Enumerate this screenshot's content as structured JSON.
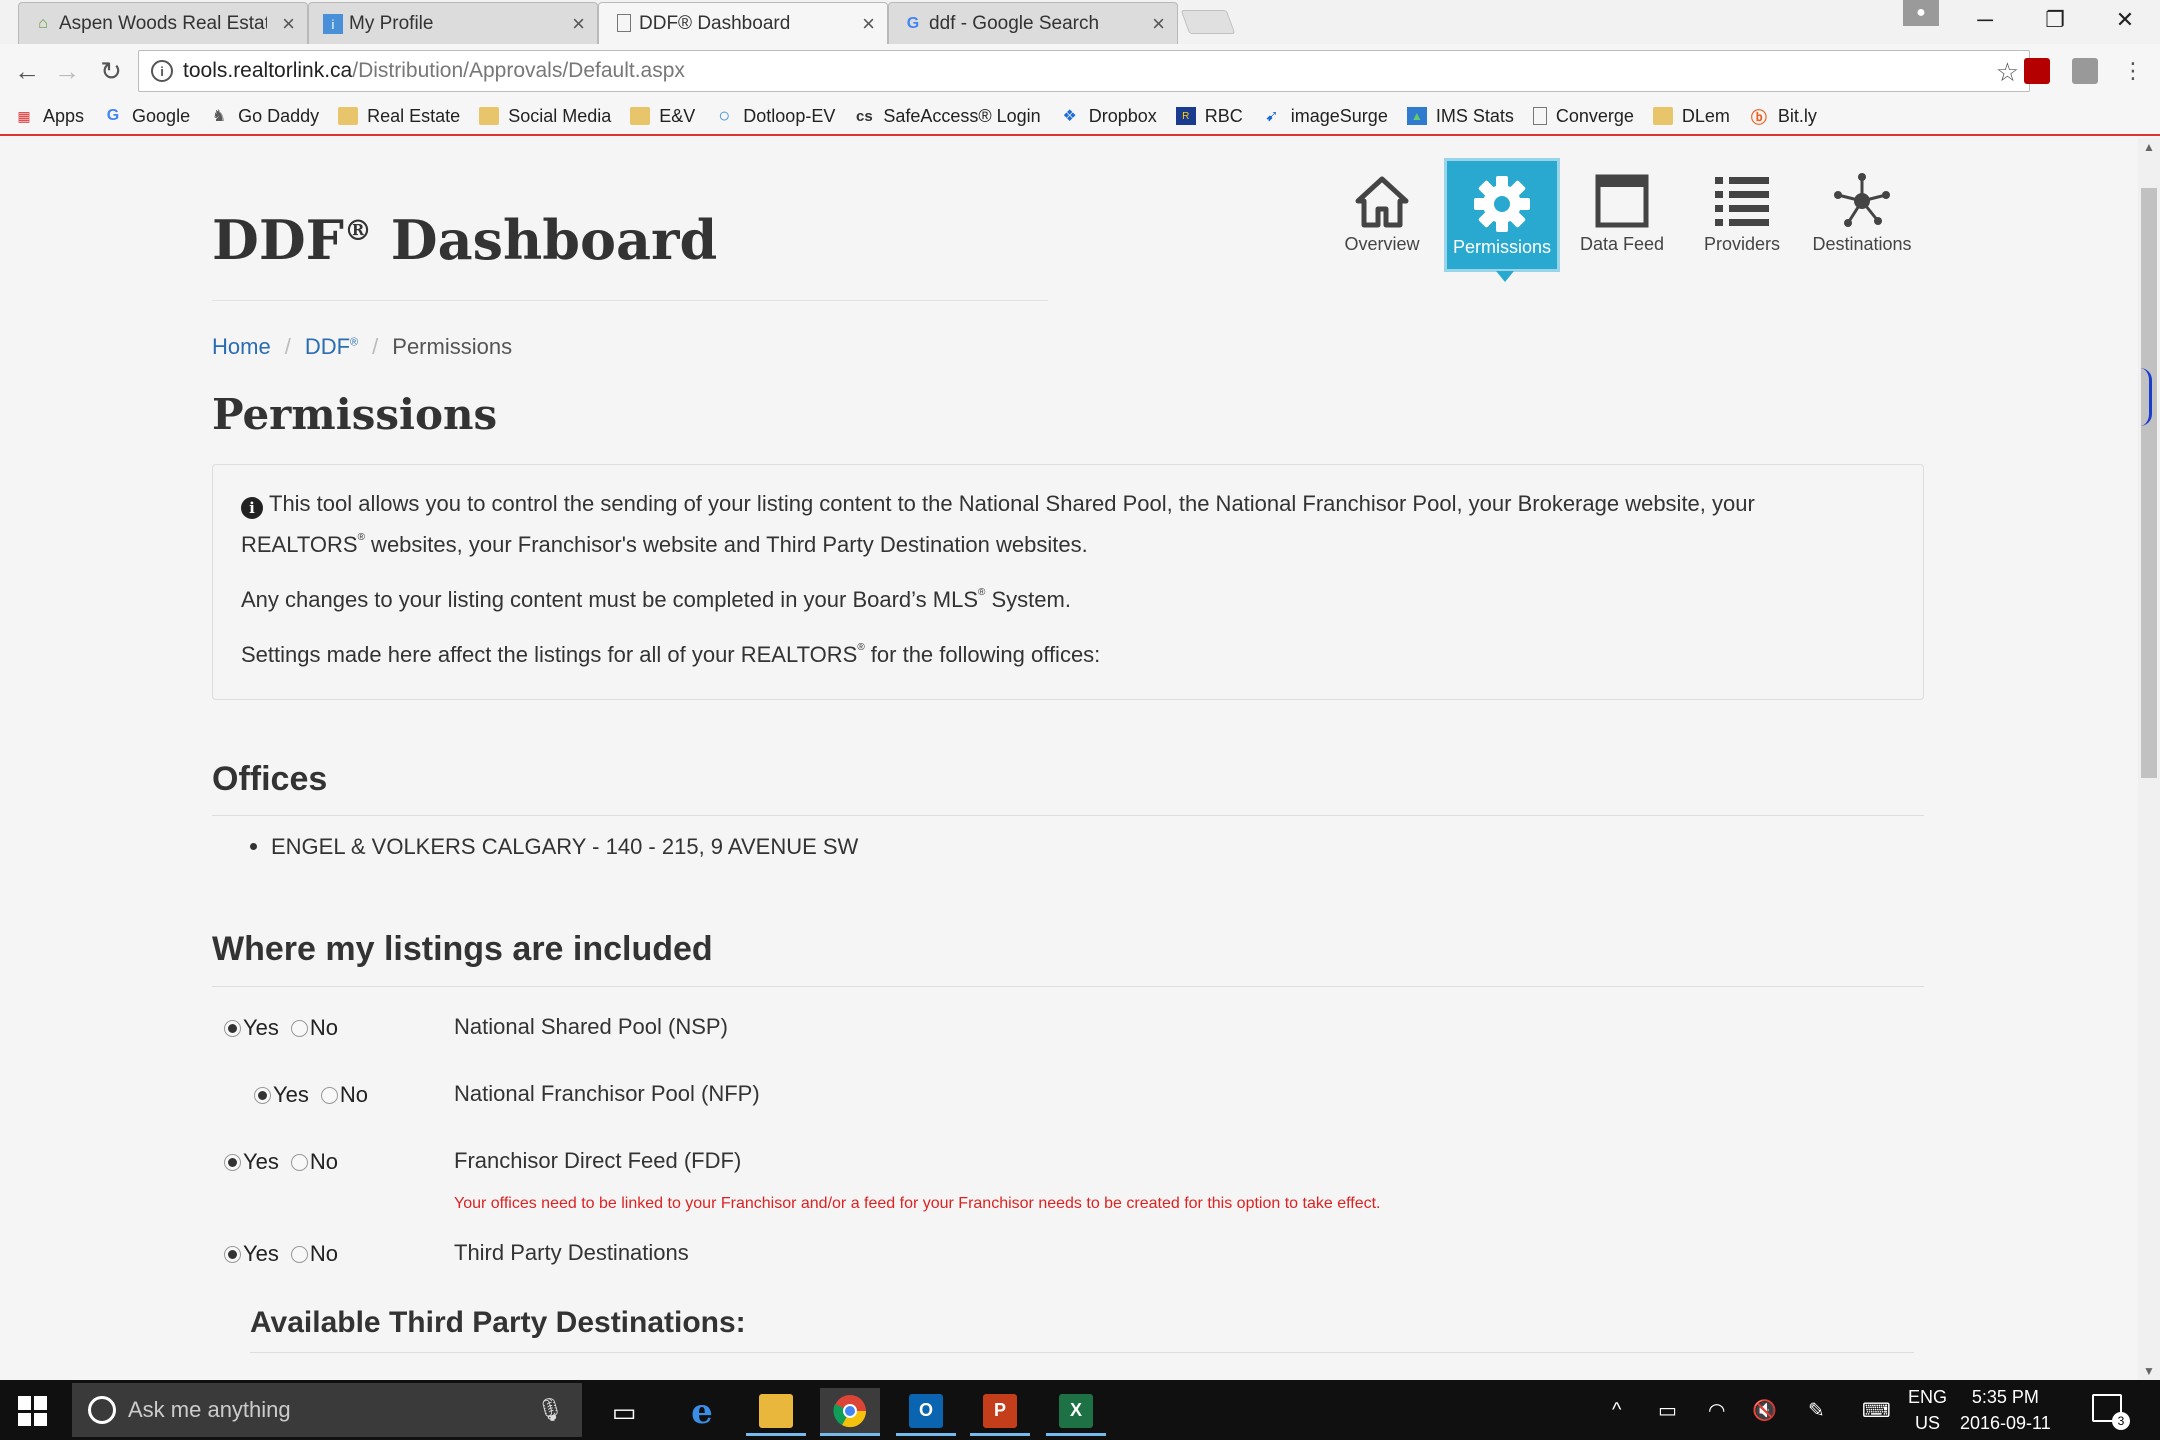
{
  "browser": {
    "tabs": [
      {
        "label": "Aspen Woods Real Estate",
        "icon": "house-favicon-icon"
      },
      {
        "label": "My Profile",
        "icon": "profile-favicon-icon"
      },
      {
        "label": "DDF® Dashboard",
        "icon": "page-favicon-icon"
      },
      {
        "label": "ddf - Google Search",
        "icon": "google-favicon-icon"
      }
    ],
    "active_tab": 2,
    "url_host": "tools.realtorlink.ca",
    "url_path": "/Distribution/Approvals/Default.aspx",
    "bookmarks": [
      {
        "label": "Apps",
        "icon": "apps-grid-icon"
      },
      {
        "label": "Google",
        "icon": "google-icon"
      },
      {
        "label": "Go Daddy",
        "icon": "godaddy-icon"
      },
      {
        "label": "Real Estate",
        "icon": "folder-icon"
      },
      {
        "label": "Social Media",
        "icon": "folder-icon"
      },
      {
        "label": "E&V",
        "icon": "folder-icon"
      },
      {
        "label": "Dotloop-EV",
        "icon": "dotloop-icon"
      },
      {
        "label": "SafeAccess® Login",
        "icon": "safeaccess-icon"
      },
      {
        "label": "Dropbox",
        "icon": "dropbox-icon"
      },
      {
        "label": "RBC",
        "icon": "rbc-icon"
      },
      {
        "label": "imageSurge",
        "icon": "imagesurge-icon"
      },
      {
        "label": "IMS Stats",
        "icon": "ims-stats-icon"
      },
      {
        "label": "Converge",
        "icon": "page-icon"
      },
      {
        "label": "DLem",
        "icon": "folder-icon"
      },
      {
        "label": "Bit.ly",
        "icon": "bitly-icon"
      }
    ]
  },
  "page": {
    "title": "DDF",
    "title_suffix": " Dashboard",
    "reg": "®",
    "nav": [
      {
        "label": "Overview",
        "icon": "home-icon",
        "active": false
      },
      {
        "label": "Permissions",
        "icon": "gear-icon",
        "active": true
      },
      {
        "label": "Data Feed",
        "icon": "window-icon",
        "active": false
      },
      {
        "label": "Providers",
        "icon": "list-icon",
        "active": false
      },
      {
        "label": "Destinations",
        "icon": "network-icon",
        "active": false
      }
    ],
    "breadcrumb": {
      "home": "Home",
      "ddf": "DDF",
      "current": "Permissions"
    },
    "section_title": "Permissions",
    "info": {
      "line1a": "This tool allows you to control the sending of your listing content to the National Shared Pool, the National Franchisor Pool, your Brokerage website, your",
      "line1b_pre": "REALTORS",
      "line1b_post": " websites, your Franchisor's website and Third Party Destination websites.",
      "line2_pre": "Any changes to your listing content must be completed in your Board’s MLS",
      "line2_post": " System.",
      "line3_pre": "Settings made here affect the listings for all of your REALTORS",
      "line3_post": " for the following offices:"
    },
    "offices_title": "Offices",
    "offices": [
      "ENGEL & VOLKERS CALGARY - 140 - 215, 9 AVENUE SW"
    ],
    "included_title": "Where my listings are included",
    "yes_label": "Yes",
    "no_label": "No",
    "options": [
      {
        "label": "National Shared Pool (NSP)",
        "value": "Yes"
      },
      {
        "label": "National Franchisor Pool (NFP)",
        "value": "Yes"
      },
      {
        "label": "Franchisor Direct Feed (FDF)",
        "value": "Yes"
      },
      {
        "label": "Third Party Destinations",
        "value": "Yes"
      }
    ],
    "fdf_warning": "Your offices need to be linked to your Franchisor and/or a feed for your Franchisor needs to be created for this option to take effect.",
    "available_title": "Available Third Party Destinations:"
  },
  "taskbar": {
    "search_placeholder": "Ask me anything",
    "lang_top": "ENG",
    "lang_bottom": "US",
    "time": "5:35 PM",
    "date": "2016-09-11",
    "notifications": "3"
  },
  "colors": {
    "accent": "#29a9cf",
    "link": "#2a6db2",
    "warning": "#dd2222"
  }
}
